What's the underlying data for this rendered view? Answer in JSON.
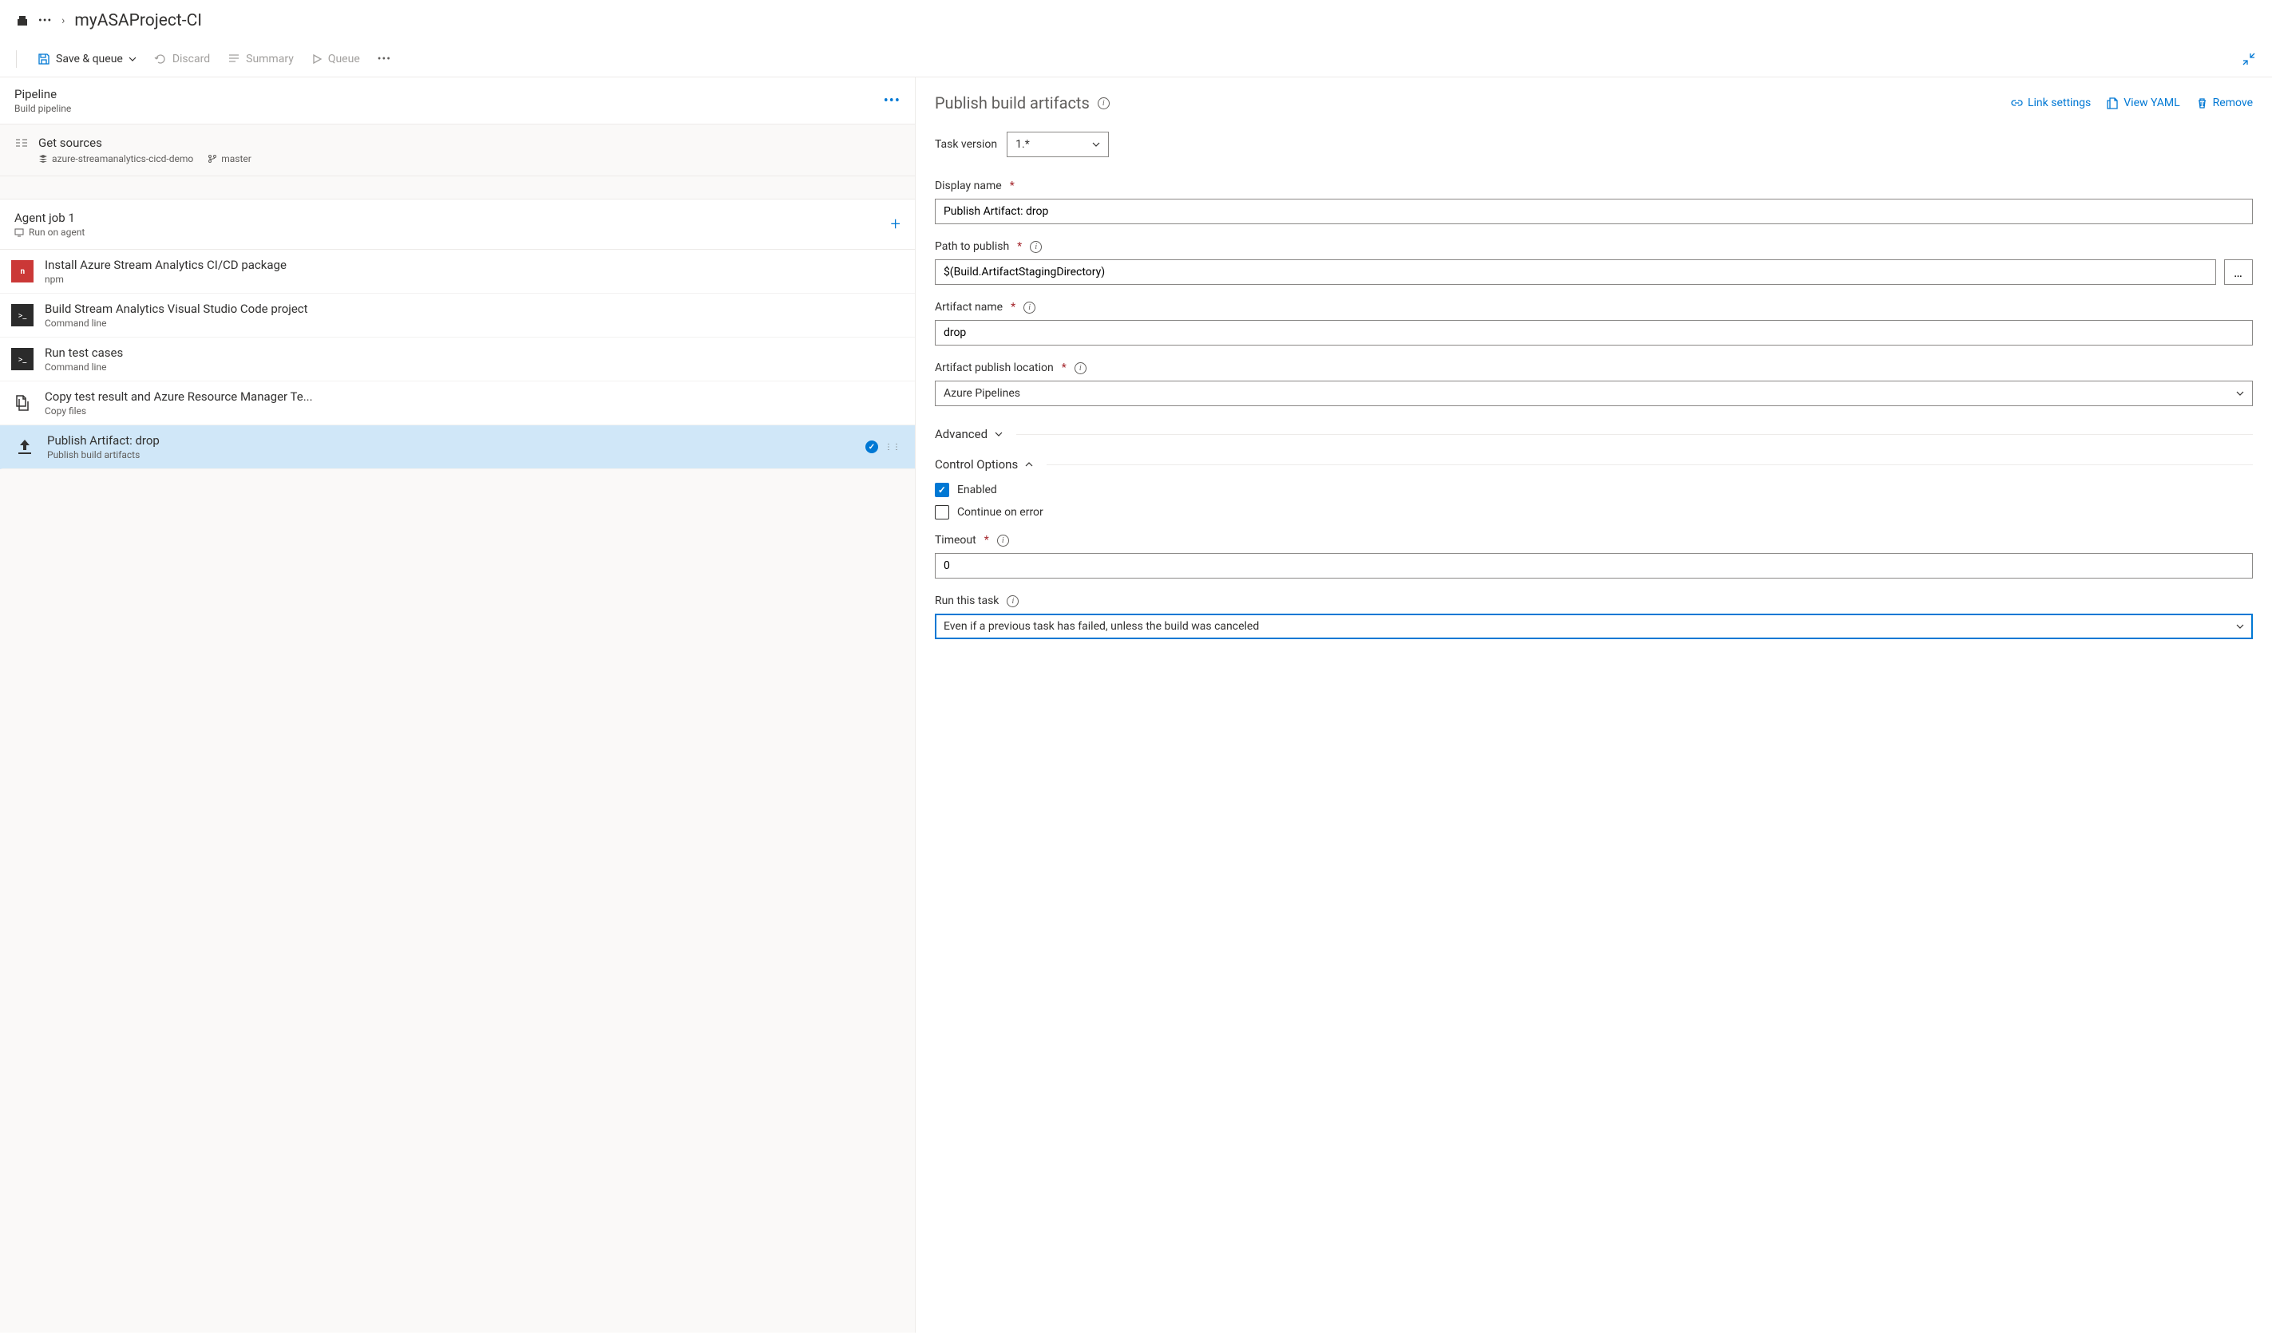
{
  "breadcrumb": {
    "title": "myASAProject-CI"
  },
  "toolbar": {
    "save_queue": "Save & queue",
    "discard": "Discard",
    "summary": "Summary",
    "queue": "Queue"
  },
  "left": {
    "pipeline_title": "Pipeline",
    "pipeline_sub": "Build pipeline",
    "sources_title": "Get sources",
    "sources_repo": "azure-streamanalytics-cicd-demo",
    "sources_branch": "master",
    "agent_title": "Agent job 1",
    "agent_sub": "Run on agent",
    "tasks": [
      {
        "title": "Install Azure Stream Analytics CI/CD package",
        "sub": "npm",
        "icon": "npm"
      },
      {
        "title": "Build Stream Analytics Visual Studio Code project",
        "sub": "Command line",
        "icon": "cli"
      },
      {
        "title": "Run test cases",
        "sub": "Command line",
        "icon": "cli"
      },
      {
        "title": "Copy test result and Azure Resource Manager Te...",
        "sub": "Copy files",
        "icon": "copy"
      },
      {
        "title": "Publish Artifact: drop",
        "sub": "Publish build artifacts",
        "icon": "upload",
        "selected": true
      }
    ]
  },
  "right": {
    "title": "Publish build artifacts",
    "link_settings": "Link settings",
    "view_yaml": "View YAML",
    "remove": "Remove",
    "task_version_label": "Task version",
    "task_version_value": "1.*",
    "display_name_label": "Display name",
    "display_name_value": "Publish Artifact: drop",
    "path_label": "Path to publish",
    "path_value": "$(Build.ArtifactStagingDirectory)",
    "artifact_name_label": "Artifact name",
    "artifact_name_value": "drop",
    "publish_location_label": "Artifact publish location",
    "publish_location_value": "Azure Pipelines",
    "advanced": "Advanced",
    "control_options": "Control Options",
    "enabled_label": "Enabled",
    "continue_label": "Continue on error",
    "timeout_label": "Timeout",
    "timeout_value": "0",
    "run_task_label": "Run this task",
    "run_task_value": "Even if a previous task has failed, unless the build was canceled"
  }
}
